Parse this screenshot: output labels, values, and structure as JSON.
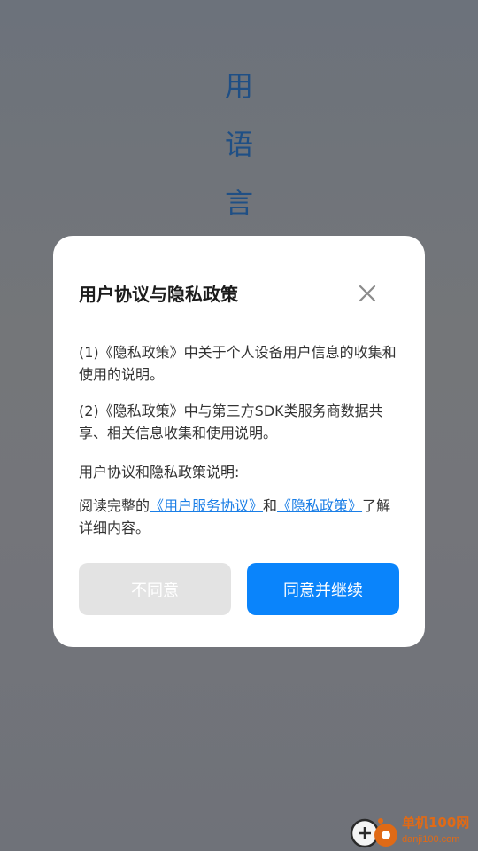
{
  "background": {
    "vertical_text": [
      "用",
      "语",
      "言"
    ],
    "text_color": "#1f4f85",
    "overlay_color": "#6f7279"
  },
  "dialog": {
    "title": "用户协议与隐私政策",
    "close_icon": "close-icon",
    "paragraph1": "(1)《隐私政策》中关于个人设备用户信息的收集和使用的说明。",
    "paragraph2": "(2)《隐私政策》中与第三方SDK类服务商数据共享、相关信息收集和使用说明。",
    "paragraph3": "用户协议和隐私政策说明:",
    "paragraph4": {
      "prefix": "阅读完整的",
      "link_terms": "《用户服务协议》",
      "middle": "和",
      "link_privacy": "《隐私政策》",
      "suffix": "了解详细内容。"
    },
    "disagree_label": "不同意",
    "agree_label": "同意并继续",
    "link_color": "#1a7ee6",
    "agree_color": "#0a84fb",
    "disagree_color": "#e3e3e3"
  },
  "watermark": {
    "title": "单机100网",
    "domain": "danji100.com",
    "icon": "gamepad-logo-icon",
    "color": "#e06a16"
  }
}
